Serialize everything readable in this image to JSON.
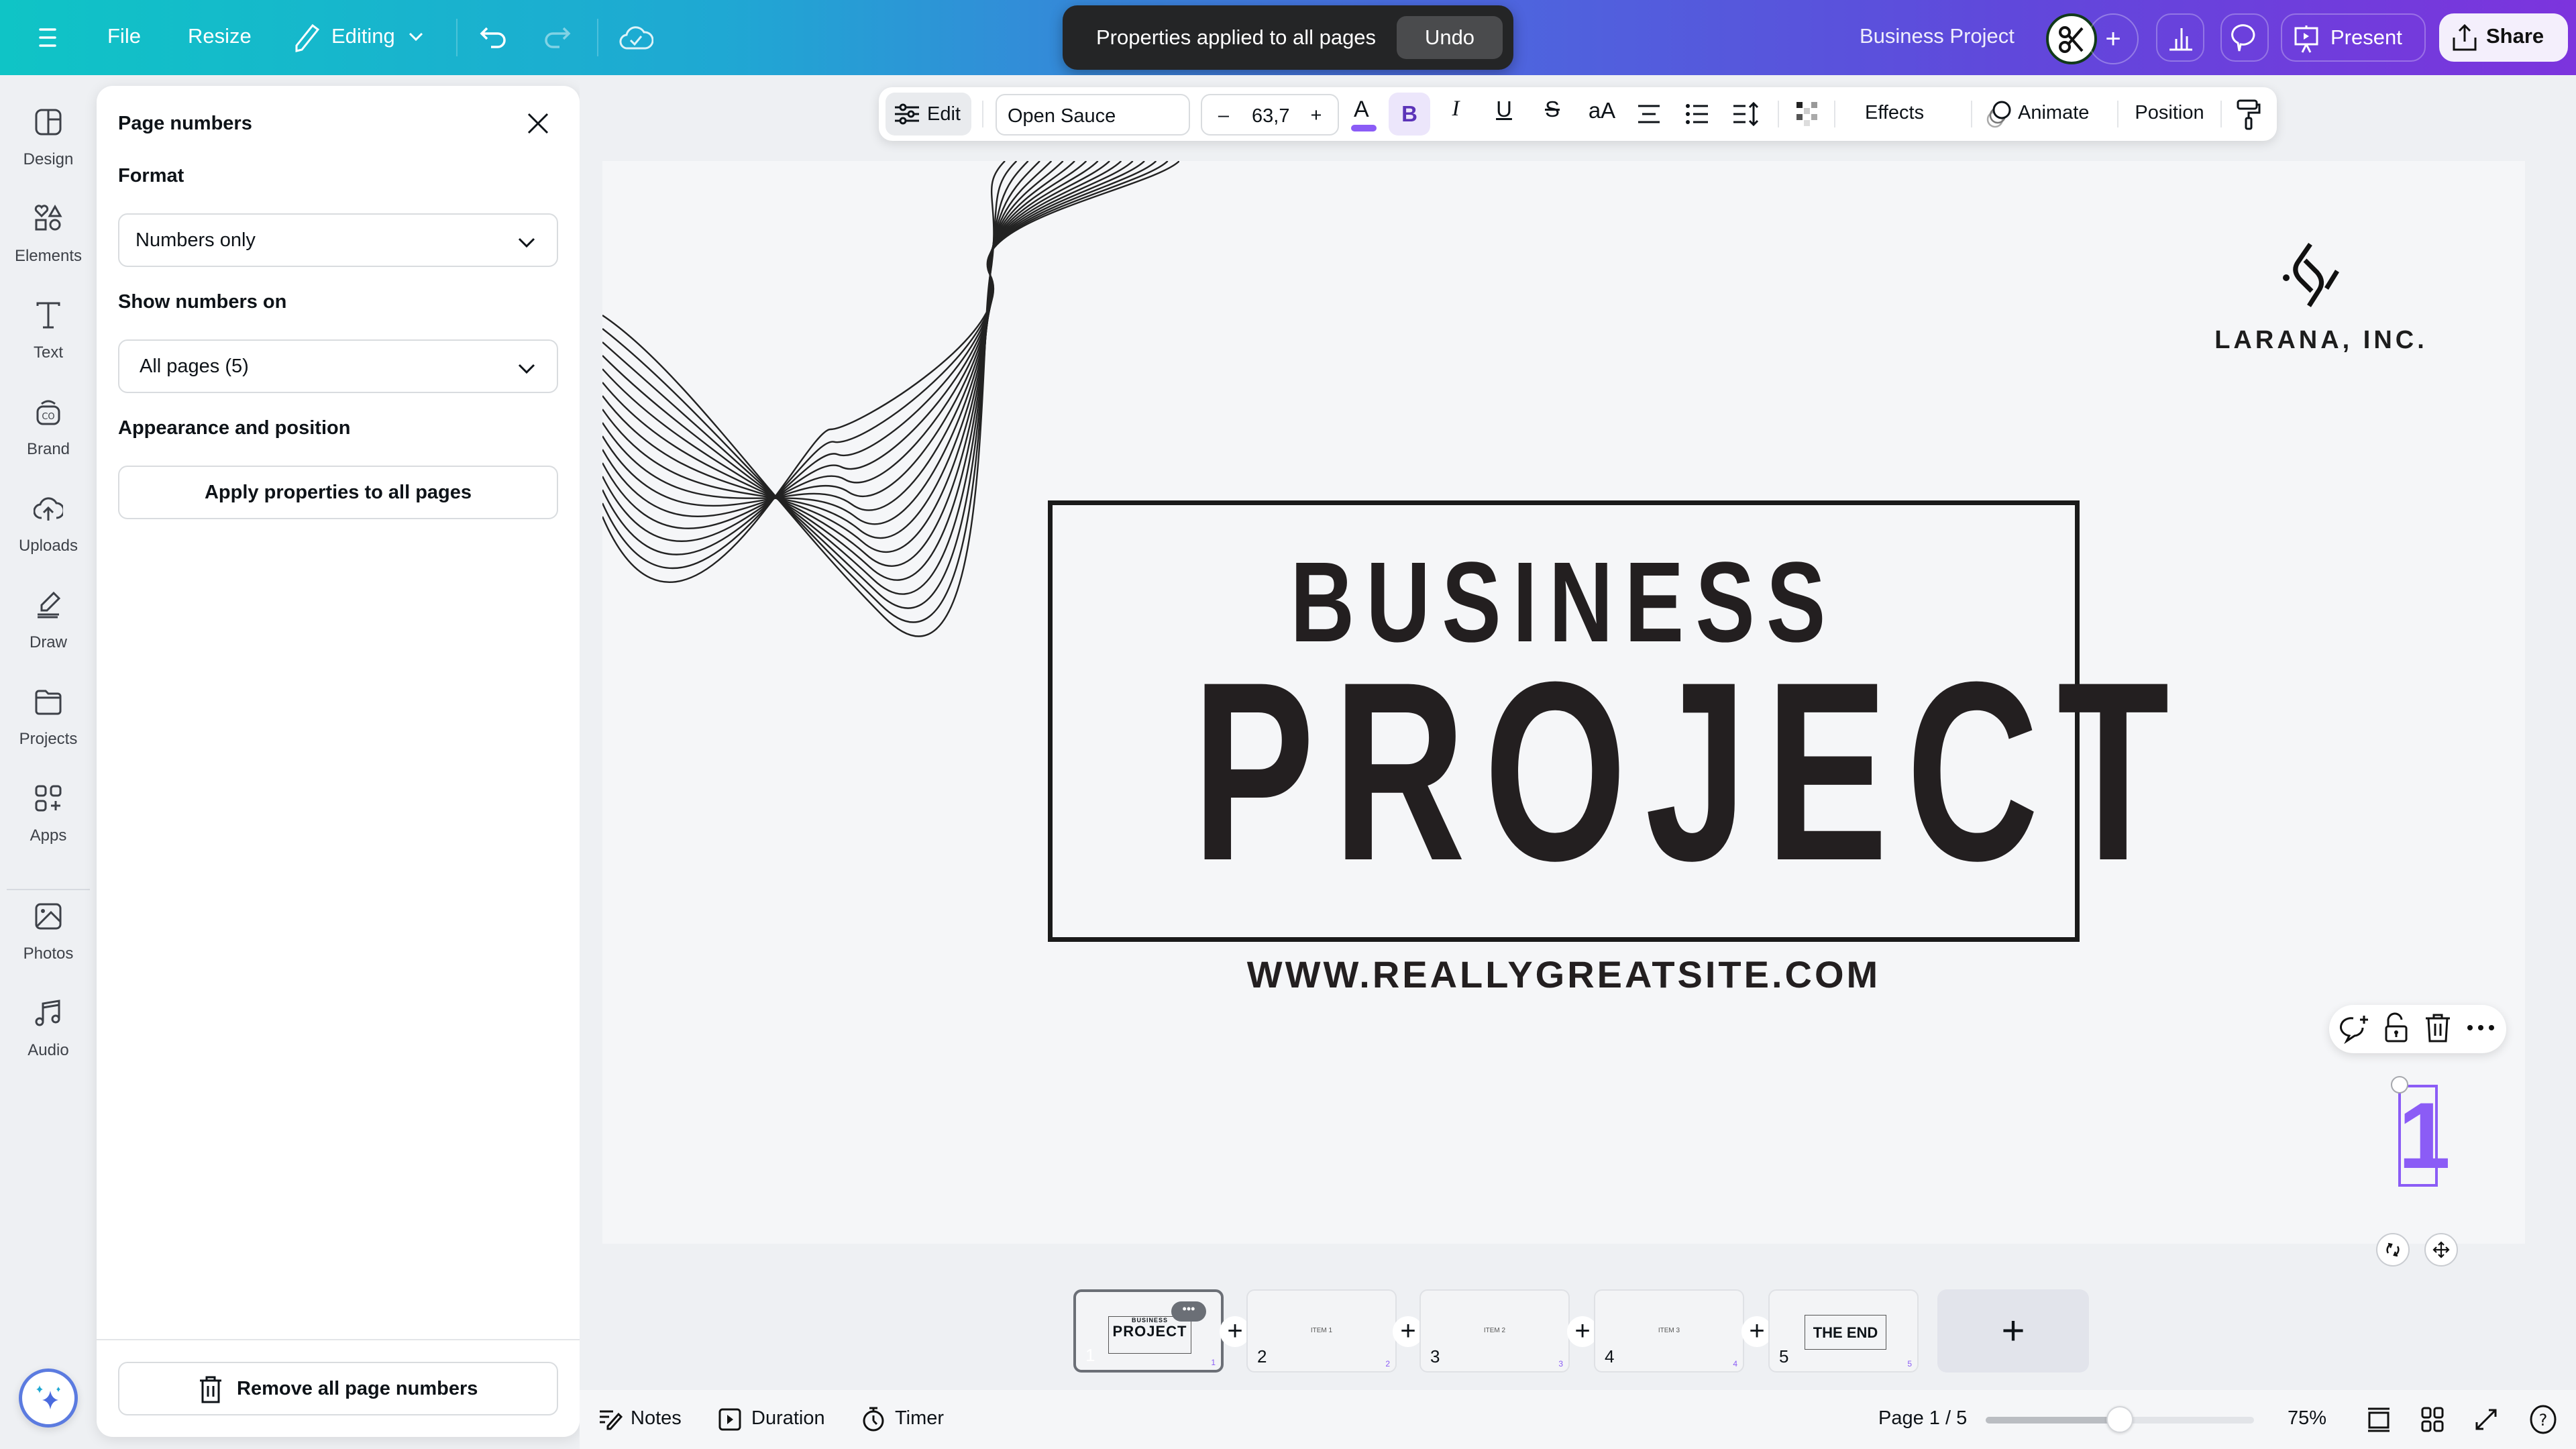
{
  "topbar": {
    "menu_icon": "hamburger-icon",
    "file": "File",
    "resize": "Resize",
    "editing": "Editing",
    "project_title": "Business Project",
    "present": "Present",
    "share": "Share",
    "avatar_icon": "scissors-icon"
  },
  "toast": {
    "message": "Properties applied to all pages",
    "undo": "Undo"
  },
  "rail": {
    "items": [
      {
        "label": "Design",
        "icon": "design-icon"
      },
      {
        "label": "Elements",
        "icon": "elements-icon"
      },
      {
        "label": "Text",
        "icon": "text-icon"
      },
      {
        "label": "Brand",
        "icon": "brand-icon"
      },
      {
        "label": "Uploads",
        "icon": "upload-icon"
      },
      {
        "label": "Draw",
        "icon": "draw-icon"
      },
      {
        "label": "Projects",
        "icon": "folder-icon"
      },
      {
        "label": "Apps",
        "icon": "apps-icon"
      },
      {
        "label": "Photos",
        "icon": "photo-icon"
      },
      {
        "label": "Audio",
        "icon": "music-icon"
      }
    ]
  },
  "panel": {
    "title": "Page numbers",
    "format_label": "Format",
    "format_value": "Numbers only",
    "show_on_label": "Show numbers on",
    "show_on_value": "All pages (5)",
    "appearance_label": "Appearance and position",
    "apply_button": "Apply properties to all pages",
    "remove_button": "Remove all page numbers"
  },
  "text_toolbar": {
    "edit": "Edit",
    "font": "Open Sauce",
    "font_size": "63,7",
    "minus": "–",
    "plus": "+",
    "bold": "B",
    "italic": "I",
    "underline": "U",
    "strike": "S",
    "case": "aA",
    "effects": "Effects",
    "animate": "Animate",
    "position": "Position",
    "text_color": "#8b5cf6"
  },
  "design": {
    "heading_small": "BUSINESS",
    "heading_large": "PROJECT",
    "url": "WWW.REALLYGREATSITE.COM",
    "logo_name": "LARANA, INC.",
    "page_number": "1"
  },
  "pages": [
    {
      "num": "1",
      "label": "BUSINESS PROJECT",
      "selected": true
    },
    {
      "num": "2",
      "label": "ITEM 1"
    },
    {
      "num": "3",
      "label": "ITEM 2"
    },
    {
      "num": "4",
      "label": "ITEM 3"
    },
    {
      "num": "5",
      "label": "THE END"
    }
  ],
  "status": {
    "notes": "Notes",
    "duration": "Duration",
    "timer": "Timer",
    "page_indicator": "Page 1 / 5",
    "zoom": "75%",
    "zoom_slider_fraction": 0.5
  },
  "colors": {
    "accent": "#8b5cf6",
    "topbar_start": "#0fc4c6",
    "topbar_end": "#7c34dd"
  }
}
